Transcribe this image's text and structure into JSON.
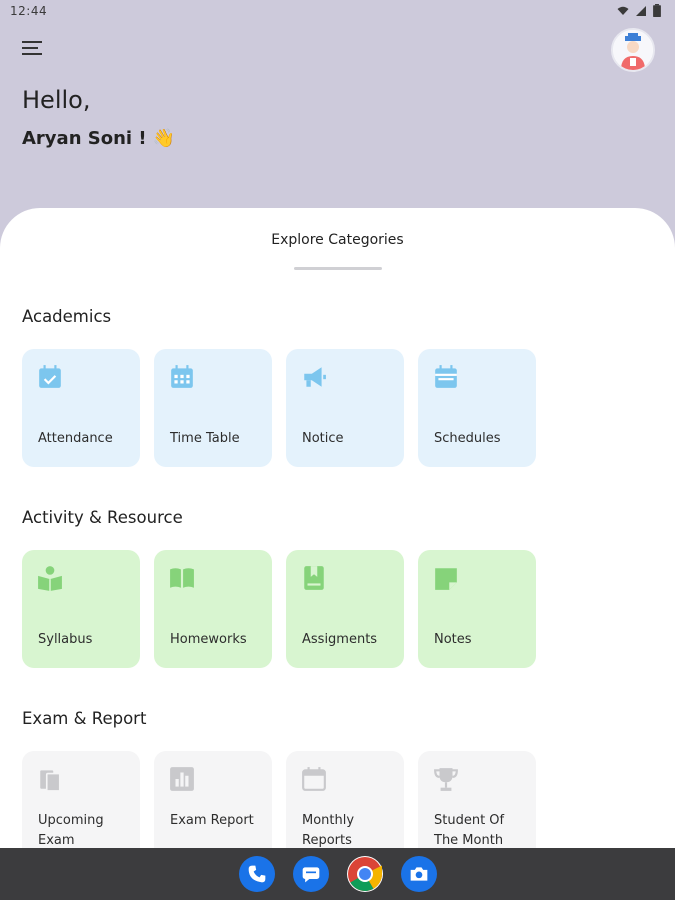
{
  "status": {
    "time": "12:44"
  },
  "header": {
    "greeting": "Hello,",
    "user_name": "Aryan Soni ! 👋"
  },
  "sheet": {
    "title": "Explore Categories",
    "sections": [
      {
        "title": "Academics",
        "cards": [
          {
            "label": "Attendance",
            "icon": "calendar-check-icon"
          },
          {
            "label": "Time Table",
            "icon": "calendar-grid-icon"
          },
          {
            "label": "Notice",
            "icon": "megaphone-icon"
          },
          {
            "label": "Schedules",
            "icon": "calendar-icon"
          }
        ]
      },
      {
        "title": "Activity & Resource",
        "cards": [
          {
            "label": "Syllabus",
            "icon": "reader-icon"
          },
          {
            "label": "Homeworks",
            "icon": "open-book-icon"
          },
          {
            "label": "Assigments",
            "icon": "bookmark-book-icon"
          },
          {
            "label": "Notes",
            "icon": "note-icon"
          }
        ]
      },
      {
        "title": "Exam & Report",
        "cards": [
          {
            "label": "Upcoming Exam",
            "icon": "clipboard-icon"
          },
          {
            "label": "Exam Report",
            "icon": "bar-chart-icon"
          },
          {
            "label": "Monthly Reports",
            "icon": "calendar-icon"
          },
          {
            "label": "Student Of The Month",
            "icon": "trophy-icon"
          }
        ]
      }
    ]
  },
  "dock": {
    "apps": [
      "phone-icon",
      "messages-icon",
      "chrome-icon",
      "camera-icon"
    ]
  },
  "colors": {
    "header_bg": "#cdcadb",
    "academics_card": "#e4f2fc",
    "activity_card": "#d8f5d0",
    "exam_card": "#f5f5f6",
    "academics_icon": "#7cc6ee",
    "activity_icon": "#86d37a",
    "exam_icon": "#c9c9cc"
  }
}
